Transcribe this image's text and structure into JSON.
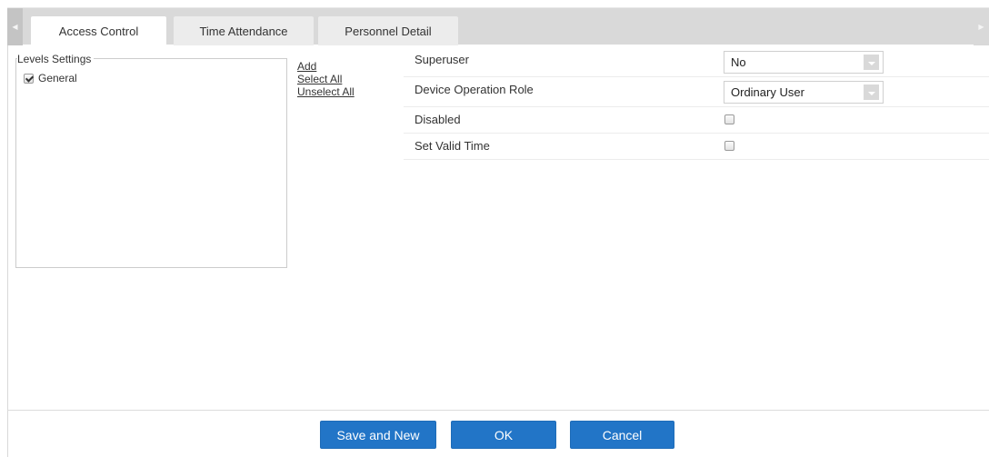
{
  "tabs": [
    {
      "label": "Access Control",
      "active": true
    },
    {
      "label": "Time Attendance",
      "active": false
    },
    {
      "label": "Personnel Detail",
      "active": false
    }
  ],
  "levels": {
    "legend": "Levels Settings",
    "items": [
      {
        "label": "General",
        "checked": true
      }
    ]
  },
  "actions": {
    "add": "Add",
    "select_all": "Select All",
    "unselect_all": "Unselect All"
  },
  "settings": {
    "superuser": {
      "label": "Superuser",
      "value": "No"
    },
    "device_role": {
      "label": "Device Operation Role",
      "value": "Ordinary User"
    },
    "disabled": {
      "label": "Disabled",
      "checked": false
    },
    "valid_time": {
      "label": "Set Valid Time",
      "checked": false
    }
  },
  "buttons": {
    "save_and_new": "Save and New",
    "ok": "OK",
    "cancel": "Cancel"
  },
  "icons": {
    "tab_scroll_left": "triangle-left-icon",
    "tab_scroll_right": "triangle-right-icon",
    "dropdown": "chevron-down-icon"
  },
  "colors": {
    "button_primary": "#2275c7",
    "tabbar_bg": "#d9d9d9"
  }
}
